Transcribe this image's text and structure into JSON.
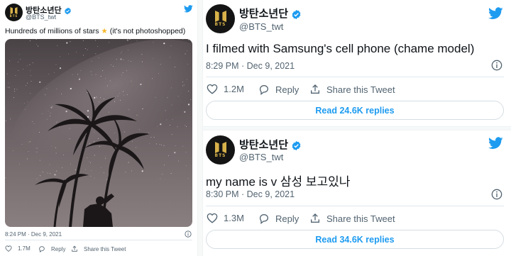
{
  "colors": {
    "accent": "#1d9bf0",
    "muted": "#536471",
    "avatar_bg": "#141414",
    "logo_gold": "#d8b24a",
    "star": "#f6b82a"
  },
  "icons": [
    "twitter-bird-icon",
    "verified-badge-icon",
    "heart-icon",
    "reply-bubble-icon",
    "share-icon",
    "info-icon",
    "star-emoji-icon"
  ],
  "avatar_logo_text": "BTS",
  "left_tweet": {
    "author_name": "방탄소년단",
    "handle": "@BTS_twt",
    "text_before_emoji": "Hundreds of millions of stars",
    "text_after_emoji": "(it's not photoshopped)",
    "timestamp": "8:24 PM · Dec 9, 2021",
    "likes": "1.7M",
    "reply_label": "Reply",
    "share_label": "Share this Tweet"
  },
  "right_top_tweet": {
    "author_name": "방탄소년단",
    "handle": "@BTS_twt",
    "text": "I filmed with Samsung's cell phone (chame model)",
    "timestamp": "8:29 PM · Dec 9, 2021",
    "likes": "1.2M",
    "reply_label": "Reply",
    "share_label": "Share this Tweet",
    "read_replies": "Read 24.6K replies"
  },
  "right_bottom_tweet": {
    "author_name": "방탄소년단",
    "handle": "@BTS_twt",
    "text": "my name is v 삼성 보고있나",
    "timestamp": "8:30 PM · Dec 9, 2021",
    "likes": "1.3M",
    "reply_label": "Reply",
    "share_label": "Share this Tweet",
    "read_replies": "Read 34.6K replies"
  }
}
